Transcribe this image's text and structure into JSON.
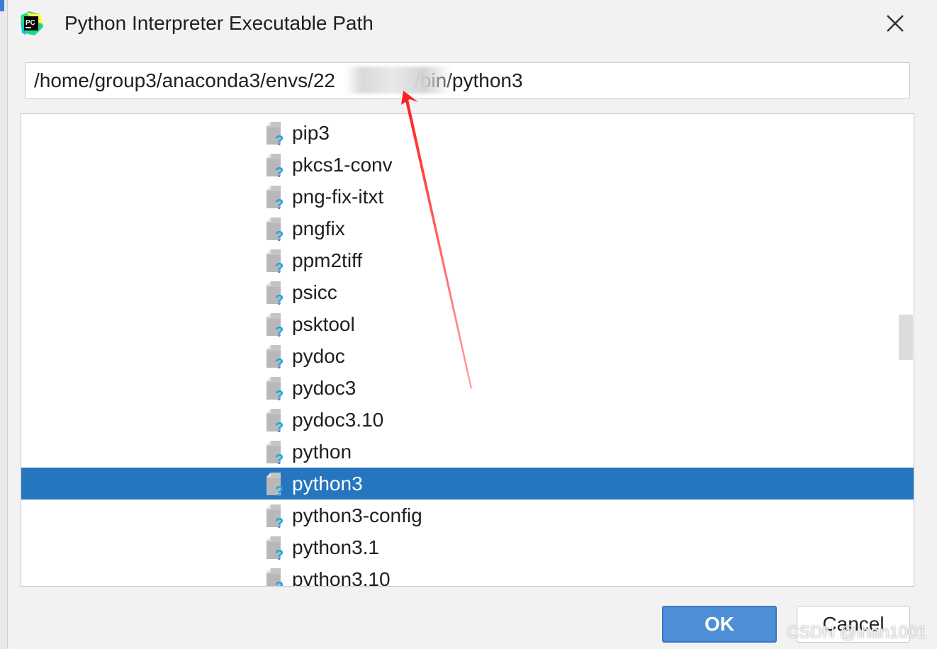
{
  "dialog": {
    "title": "Python Interpreter Executable Path",
    "path_value": "/home/group3/anaconda3/envs/22    /bin/python3",
    "path_prefix": "/home/group3/anaconda3/envs/22",
    "path_suffix": "/bin/python3"
  },
  "tree": {
    "items": [
      {
        "label": "pip3",
        "selected": false
      },
      {
        "label": "pkcs1-conv",
        "selected": false
      },
      {
        "label": "png-fix-itxt",
        "selected": false
      },
      {
        "label": "pngfix",
        "selected": false
      },
      {
        "label": "ppm2tiff",
        "selected": false
      },
      {
        "label": "psicc",
        "selected": false
      },
      {
        "label": "psktool",
        "selected": false
      },
      {
        "label": "pydoc",
        "selected": false
      },
      {
        "label": "pydoc3",
        "selected": false
      },
      {
        "label": "pydoc3.10",
        "selected": false
      },
      {
        "label": "python",
        "selected": false
      },
      {
        "label": "python3",
        "selected": true
      },
      {
        "label": "python3-config",
        "selected": false
      },
      {
        "label": "python3.1",
        "selected": false
      },
      {
        "label": "python3.10",
        "selected": false
      }
    ]
  },
  "buttons": {
    "ok_label": "OK",
    "cancel_label": "Cancel"
  },
  "watermark": "CSDN @lhan1001",
  "colors": {
    "selection": "#2675bf",
    "ok_button": "#4d8fd6",
    "annotation_arrow": "#ff2a2a"
  },
  "icons": {
    "app": "pycharm-logo-icon",
    "close": "close-icon",
    "file": "unknown-file-icon"
  }
}
